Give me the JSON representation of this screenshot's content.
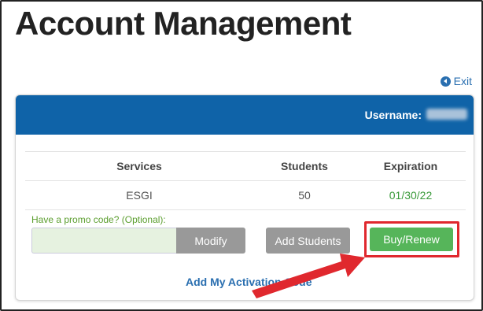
{
  "page": {
    "title_regular": "Account ",
    "title_bold": "Management"
  },
  "exit": {
    "label": "Exit",
    "icon": "circle-chevron-left-icon"
  },
  "panel": {
    "header": {
      "username_label": "Username:",
      "username_value_redacted": true
    },
    "table": {
      "headers": {
        "services": "Services",
        "students": "Students",
        "expiration": "Expiration"
      },
      "rows": [
        {
          "service": "ESGI",
          "students": "50",
          "expiration": "01/30/22"
        }
      ]
    },
    "promo": {
      "label": "Have a promo code? (Optional):",
      "value": ""
    },
    "buttons": {
      "modify": "Modify",
      "add_students": "Add Students",
      "buy_renew": "Buy/Renew"
    },
    "activation_link": "Add My Activation Code"
  },
  "colors": {
    "header_blue": "#0f63a8",
    "buy_green": "#56b55a",
    "gray_button": "#999999",
    "highlight_red": "#e0282e",
    "expiration_green": "#3a9a3a",
    "link_blue": "#2a6fb0"
  }
}
